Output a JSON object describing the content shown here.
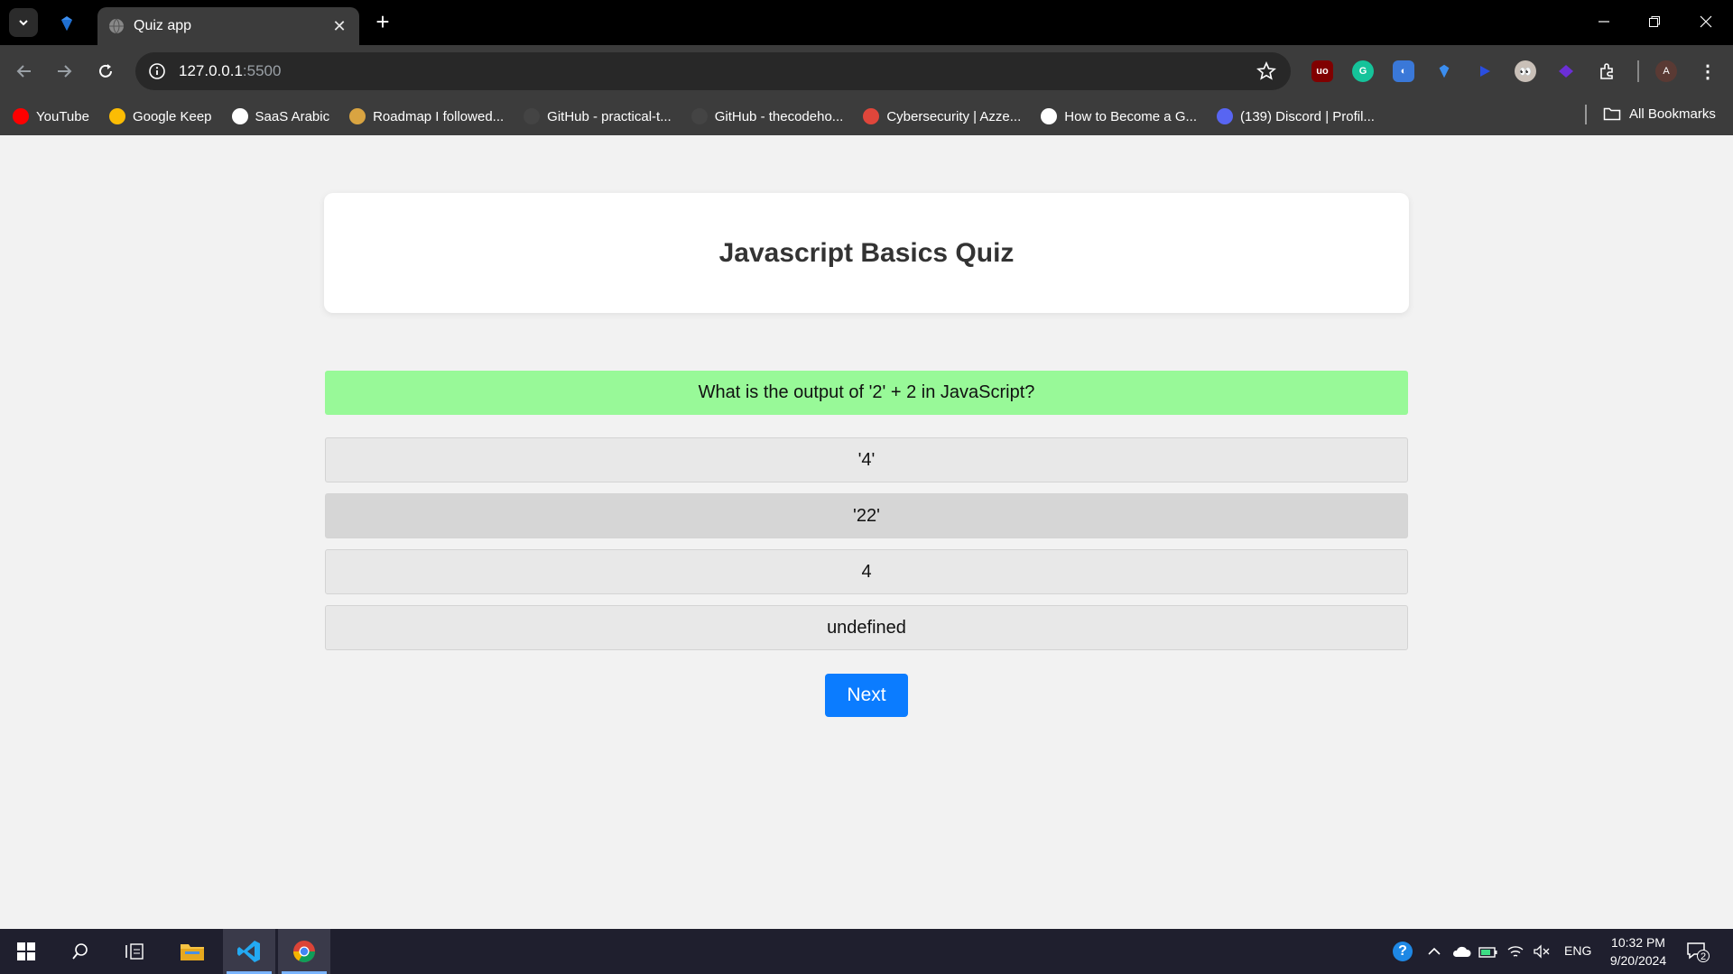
{
  "browser": {
    "tab_title": "Quiz app",
    "url_host": "127.0.0.1",
    "url_port": ":5500"
  },
  "bookmarks": [
    {
      "label": "YouTube",
      "icon": "youtube-icon",
      "color": "#ff0000"
    },
    {
      "label": "Google Keep",
      "icon": "google-keep-icon",
      "color": "#fbbc04"
    },
    {
      "label": "SaaS Arabic",
      "icon": "dollar-icon",
      "color": "#ffffff"
    },
    {
      "label": "Roadmap I followed...",
      "icon": "moneybag-icon",
      "color": "#d9a441"
    },
    {
      "label": "GitHub - practical-t...",
      "icon": "github-icon",
      "color": "#444444"
    },
    {
      "label": "GitHub - thecodeho...",
      "icon": "github-icon",
      "color": "#444444"
    },
    {
      "label": "Cybersecurity | Azze...",
      "icon": "cybersecurity-icon",
      "color": "#e0463b"
    },
    {
      "label": "How to Become a G...",
      "icon": "medium-icon",
      "color": "#ffffff"
    },
    {
      "label": "(139) Discord | Profil...",
      "icon": "discord-icon",
      "color": "#5865f2"
    }
  ],
  "all_bookmarks_label": "All Bookmarks",
  "profile_initial": "A",
  "quiz": {
    "title": "Javascript Basics Quiz",
    "question": "What is the output of '2' + 2 in JavaScript?",
    "options": [
      "'4'",
      "'22'",
      "4",
      "undefined"
    ],
    "next_label": "Next"
  },
  "taskbar": {
    "language": "ENG",
    "time": "10:32 PM",
    "date": "9/20/2024",
    "notification_count": "2"
  },
  "colors": {
    "question_bg": "#98f998",
    "next_button": "#0b7cff"
  }
}
